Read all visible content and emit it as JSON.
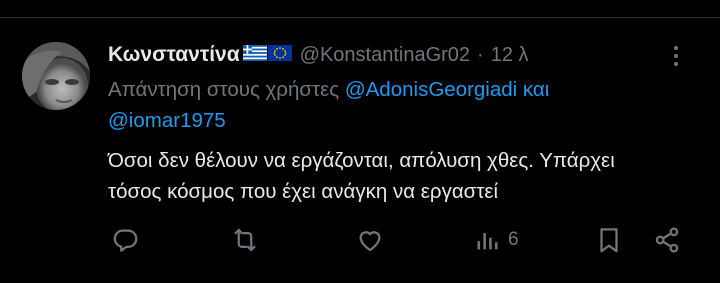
{
  "tweet": {
    "display_name": "Κωνσταντίνα",
    "flag_icons": [
      "greece-flag-icon",
      "eu-flag-icon"
    ],
    "handle": "@KonstantinaGr02",
    "separator": "·",
    "time": "12 λ",
    "reply_prefix": "Απάντηση στους χρήστες",
    "mention_1": "@AdonisGeorgiadi",
    "conjunction": "και",
    "mention_2": "@iomar1975",
    "text_line_1": "Όσοι δεν θέλουν να εργάζονται, απόλυση χθες. Υπάρχει",
    "text_line_2": "τόσος κόσμος που έχει ανάγκη να εργαστεί",
    "views_count": "6"
  },
  "colors": {
    "background": "#000000",
    "text": "#e7e9ea",
    "muted": "#71767b",
    "link": "#1d9bf0"
  },
  "icons": [
    "reply-icon",
    "retweet-icon",
    "like-icon",
    "views-icon",
    "bookmark-icon",
    "share-icon",
    "more-icon"
  ]
}
